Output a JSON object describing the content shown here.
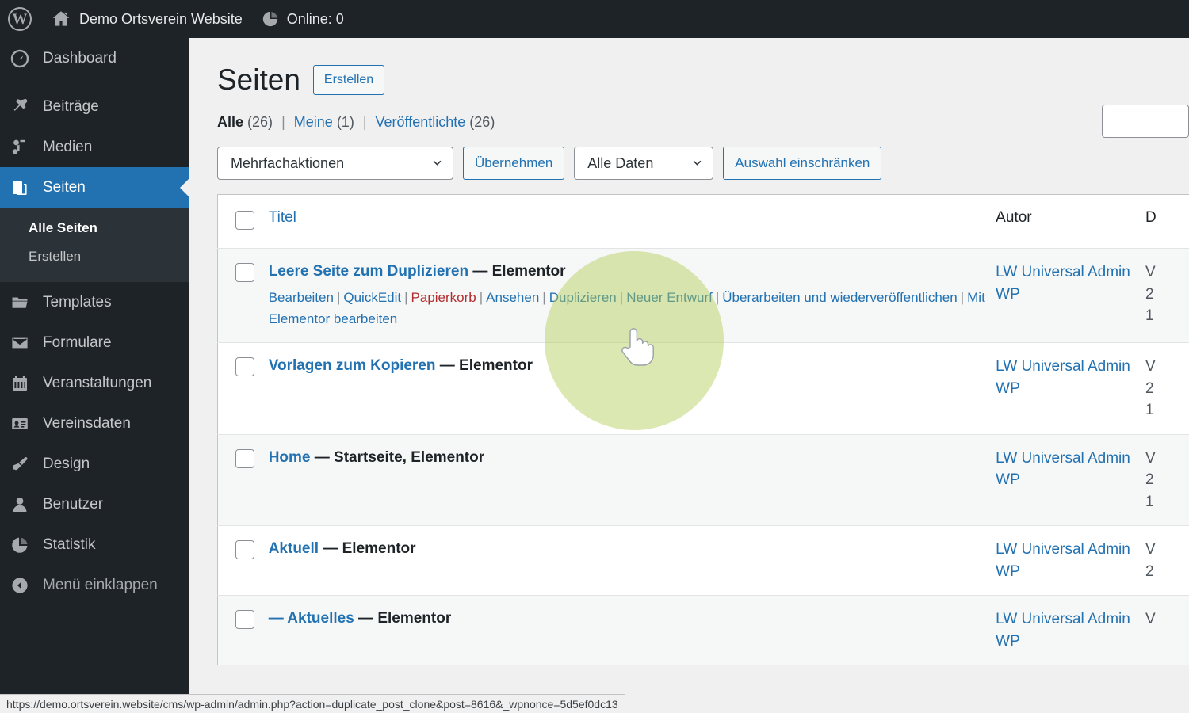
{
  "adminbar": {
    "wp_logo": "wordpress-logo",
    "site_name": "Demo Ortsverein Website",
    "online_label": "Online: 0"
  },
  "sidebar": {
    "items": [
      {
        "label": "Dashboard",
        "icon": "dashboard-icon"
      },
      {
        "label": "Beiträge",
        "icon": "pin-icon"
      },
      {
        "label": "Medien",
        "icon": "media-icon"
      },
      {
        "label": "Seiten",
        "icon": "pages-icon",
        "current": true
      },
      {
        "label": "Templates",
        "icon": "folder-icon"
      },
      {
        "label": "Formulare",
        "icon": "envelope-icon"
      },
      {
        "label": "Veranstaltungen",
        "icon": "calendar-icon"
      },
      {
        "label": "Vereinsdaten",
        "icon": "id-card-icon"
      },
      {
        "label": "Design",
        "icon": "brush-icon"
      },
      {
        "label": "Benutzer",
        "icon": "user-icon"
      },
      {
        "label": "Statistik",
        "icon": "pie-chart-icon"
      },
      {
        "label": "Menü einklappen",
        "icon": "collapse-arrow-icon"
      }
    ],
    "submenu": [
      {
        "label": "Alle Seiten",
        "current": true
      },
      {
        "label": "Erstellen",
        "current": false
      }
    ]
  },
  "page": {
    "title": "Seiten",
    "create_button": "Erstellen"
  },
  "views": [
    {
      "label": "Alle",
      "count": "(26)",
      "current": true
    },
    {
      "label": "Meine",
      "count": "(1)",
      "current": false
    },
    {
      "label": "Veröffentlichte",
      "count": "(26)",
      "current": false
    }
  ],
  "tablenav": {
    "bulk_action_value": "Mehrfachaktionen",
    "apply_button": "Übernehmen",
    "date_filter_value": "Alle Daten",
    "filter_button": "Auswahl einschränken"
  },
  "search": {
    "value": "",
    "placeholder": ""
  },
  "table": {
    "columns": {
      "title": "Titel",
      "author": "Autor",
      "date": "D"
    },
    "rows": [
      {
        "title": "Leere Seite zum Duplizieren",
        "title_suffix": " — Elementor",
        "author": "LW Universal Admin WP",
        "date": "V\n2\n1",
        "actions": [
          {
            "label": "Bearbeiten",
            "kind": "link"
          },
          {
            "label": "QuickEdit",
            "kind": "link"
          },
          {
            "label": "Papierkorb",
            "kind": "trash"
          },
          {
            "label": "Ansehen",
            "kind": "link"
          },
          {
            "label": "Duplizieren",
            "kind": "link"
          },
          {
            "label": "Neuer Entwurf",
            "kind": "link"
          },
          {
            "label": "Überarbeiten und wiederveröffentlichen",
            "kind": "link"
          },
          {
            "label": "Mit Elementor bearbeiten",
            "kind": "link"
          }
        ]
      },
      {
        "title": "Vorlagen zum Kopieren",
        "title_suffix": " — Elementor",
        "author": "LW Universal Admin WP",
        "date": "V\n2\n1",
        "actions": []
      },
      {
        "title": "Home",
        "title_suffix": " — Startseite, Elementor",
        "author": "LW Universal Admin WP",
        "date": "V\n2\n1",
        "actions": []
      },
      {
        "title": "Aktuell",
        "title_suffix": " — Elementor",
        "author": "LW Universal Admin WP",
        "date": "V\n2",
        "actions": []
      },
      {
        "title": "— Aktuelles",
        "title_suffix": " — Elementor",
        "author": "LW Universal Admin WP",
        "date": "V",
        "actions": []
      }
    ]
  },
  "statusbar": {
    "url": "https://demo.ortsverein.website/cms/wp-admin/admin.php?action=duplicate_post_clone&post=8616&_wpnonce=5d5ef0dc13"
  },
  "colors": {
    "admin_dark": "#1d2327",
    "accent_blue": "#2271b1",
    "trash_red": "#b32d2e",
    "highlight": "#b2cd54"
  }
}
